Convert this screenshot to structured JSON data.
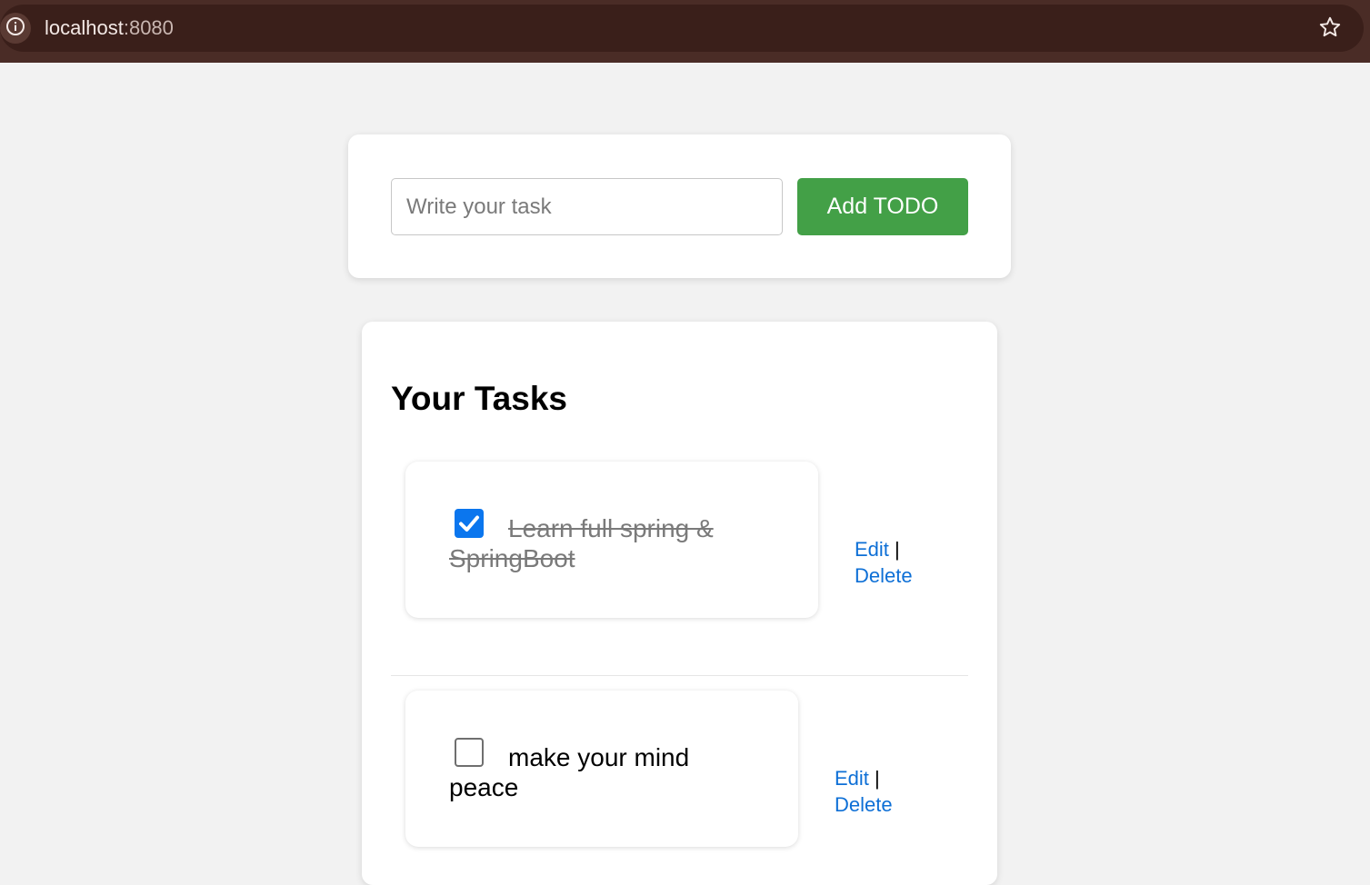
{
  "browser": {
    "url_host": "localhost",
    "url_port": ":8080"
  },
  "add_form": {
    "placeholder": "Write your task",
    "button_label": "Add TODO"
  },
  "tasks_section": {
    "title": "Your Tasks",
    "tasks": [
      {
        "text": "Learn full spring & SpringBoot",
        "completed": true,
        "edit_label": "Edit",
        "separator": "|",
        "delete_label": "Delete"
      },
      {
        "text": "make your mind peace",
        "completed": false,
        "edit_label": "Edit",
        "separator": "|",
        "delete_label": "Delete"
      }
    ]
  },
  "colors": {
    "accent_green": "#43a047",
    "link_blue": "#0d6fd6",
    "checkbox_blue": "#0b76ee",
    "browser_bar": "#3a1f1a"
  },
  "icons": [
    "info-icon",
    "star-icon",
    "checkmark-icon"
  ]
}
